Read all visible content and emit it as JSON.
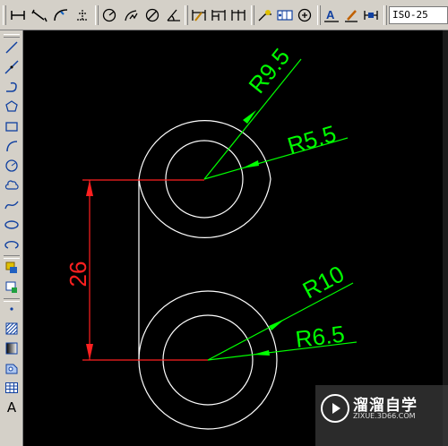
{
  "dim_toolbar": {
    "buttons": [
      {
        "icon": "linear-dimension-icon"
      },
      {
        "icon": "aligned-dimension-icon"
      },
      {
        "icon": "arc-length-icon"
      },
      {
        "icon": "ordinate-dimension-icon"
      },
      {
        "icon": "radius-dimension-icon"
      },
      {
        "icon": "jogged-dimension-icon"
      },
      {
        "icon": "diameter-dimension-icon"
      },
      {
        "icon": "angular-dimension-icon"
      },
      {
        "icon": "quick-dimension-icon"
      },
      {
        "icon": "baseline-dimension-icon"
      },
      {
        "icon": "continue-dimension-icon"
      },
      {
        "icon": "quick-leader-icon"
      },
      {
        "icon": "tolerance-icon"
      },
      {
        "icon": "center-mark-icon"
      },
      {
        "icon": "dimension-edit-icon"
      },
      {
        "icon": "dimension-text-edit-icon"
      },
      {
        "icon": "dimension-update-icon"
      }
    ],
    "dim_style_value": "ISO-25"
  },
  "draw_toolbar": {
    "buttons": [
      {
        "icon": "line-icon"
      },
      {
        "icon": "construction-line-icon"
      },
      {
        "icon": "polyline-icon"
      },
      {
        "icon": "polygon-icon"
      },
      {
        "icon": "rectangle-icon"
      },
      {
        "icon": "arc-icon"
      },
      {
        "icon": "circle-icon"
      },
      {
        "icon": "revision-cloud-icon"
      },
      {
        "icon": "spline-icon"
      },
      {
        "icon": "ellipse-icon"
      },
      {
        "icon": "ellipse-arc-icon"
      },
      {
        "icon": "insert-block-icon"
      },
      {
        "icon": "make-block-icon"
      },
      {
        "icon": "point-icon"
      },
      {
        "icon": "hatch-icon"
      },
      {
        "icon": "gradient-icon"
      },
      {
        "icon": "region-icon"
      },
      {
        "icon": "table-icon"
      },
      {
        "icon": "multiline-text-icon"
      }
    ],
    "text_button_label": "A"
  },
  "drawing": {
    "colors": {
      "background": "#000000",
      "geometry": "#ffffff",
      "dimension": "#ff2020",
      "leader": "#00ff00"
    },
    "dimensions": {
      "vertical_distance": "26",
      "radius_outer_top": "R9.5",
      "radius_inner_top": "R5.5",
      "radius_outer_bottom": "R10",
      "radius_inner_bottom": "R6.5"
    }
  },
  "watermark": {
    "title": "溜溜自学",
    "url": "ZIXUE.3D66.COM"
  }
}
